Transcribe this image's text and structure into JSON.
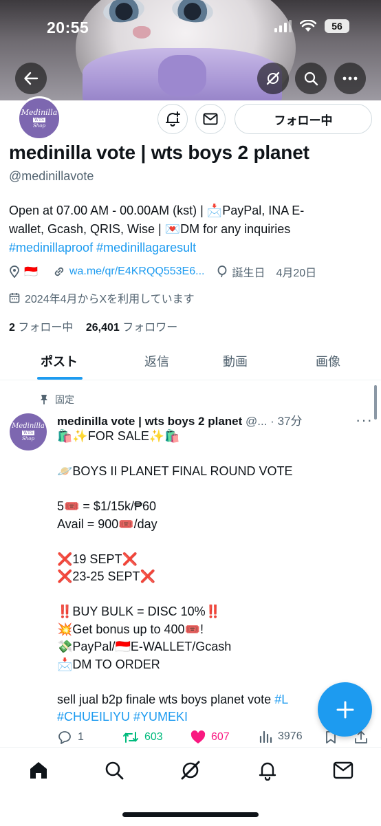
{
  "status_bar": {
    "time": "20:55",
    "battery": "56"
  },
  "profile": {
    "avatar_text": [
      "Medinilla",
      "WTS",
      "Shop"
    ],
    "follow_button": "フォロー中",
    "display_name": "medinilla vote | wts boys 2 planet",
    "handle": "@medinillavote",
    "bio_lines": [
      "Open at 07.00 AM - 00.00AM (kst) | 📩PayPal, INA E-",
      "wallet, Gcash, QRIS, Wise | 💌DM for any inquiries"
    ],
    "bio_hashtags": "#medinillaproof #medinillagaresult",
    "location_flag": "🇮🇩",
    "link": "wa.me/qr/E4KRQQ553E6...",
    "birthday_label": "誕生日",
    "birthday": "4月20日",
    "joined": "2024年4月からXを利用しています",
    "following_count": "2",
    "following_label": "フォロー中",
    "followers_count": "26,401",
    "followers_label": "フォロワー"
  },
  "tabs": [
    "ポスト",
    "返信",
    "動画",
    "画像"
  ],
  "post": {
    "pinned_label": "固定",
    "author_name": "medinilla vote | wts boys 2 planet",
    "author_handle": "@...",
    "time": "37分",
    "lines": [
      "🛍️✨FOR SALE✨🛍️",
      "",
      "🪐BOYS II PLANET FINAL ROUND VOTE",
      "",
      "5🎟️ = $1/15k/₱60",
      "Avail = 900🎟️/day",
      "",
      "❌19 SEPT❌",
      "❌23-25 SEPT❌",
      "",
      "‼️BUY BULK = DISC 10%‼️",
      "💥Get bonus up to 400🎟️!",
      "💸PayPal/🇮🇩E-WALLET/Gcash",
      "📩DM TO ORDER",
      ""
    ],
    "tags_line1_text": "sell jual b2p finale wts boys planet vote ",
    "tags_line1_tag": "#L",
    "tags_line2": "#CHUEILIYU #YUMEKI",
    "replies": "1",
    "reposts": "603",
    "likes": "607",
    "views": "3976"
  },
  "colors": {
    "accent": "#1d9bf0",
    "repost": "#00ba7c",
    "like": "#f91880",
    "text": "#0f1419",
    "muted": "#536471"
  },
  "icons": {
    "banner": [
      "back-arrow-icon",
      "grok-icon",
      "search-icon",
      "more-icon"
    ],
    "nav": [
      "home-icon",
      "search-icon",
      "grok-icon",
      "bell-icon",
      "mail-icon"
    ]
  }
}
